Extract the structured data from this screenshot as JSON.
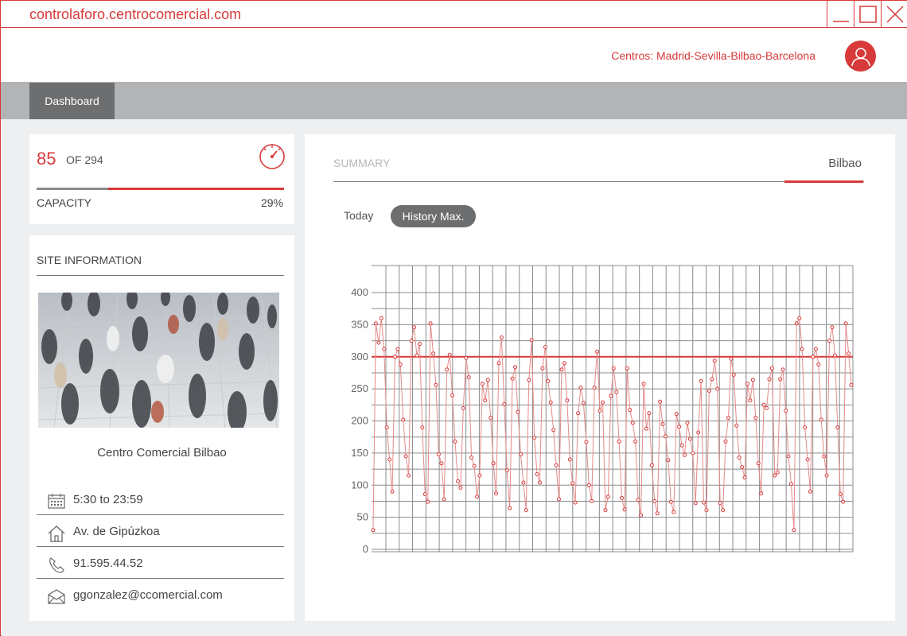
{
  "window": {
    "url": "controlaforo.centrocomercial.com"
  },
  "header": {
    "centros": "Centros: Madrid-Sevilla-Bilbao-Barcelona"
  },
  "nav": {
    "tabs": [
      {
        "label": "Dashboard",
        "active": true
      }
    ]
  },
  "capacity": {
    "count": "85",
    "of_text": "OF 294",
    "label": "CAPACITY",
    "percent_text": "29%",
    "fraction": 0.29
  },
  "site": {
    "heading": "SITE INFORMATION",
    "name": "Centro Comercial Bilbao",
    "hours": "5:30 to 23:59",
    "address": "Av. de Gipúzkoa",
    "phone": "91.595.44.52",
    "email": "ggonzalez@ccomercial.com"
  },
  "summary": {
    "tab": "SUMMARY",
    "location": "Bilbao",
    "filters": {
      "today": "Today",
      "history": "History Max."
    }
  },
  "colors": {
    "accent": "#d83a3a",
    "dark_gray": "#6d6e70",
    "nav_gray": "#b3b4b6",
    "background": "#eeeff1"
  },
  "icons": {
    "window_buttons": [
      "minimize-icon",
      "maximize-icon",
      "close-icon"
    ],
    "user": "user-icon",
    "gauge": "speedometer-icon",
    "rows": [
      "calendar-icon",
      "home-icon",
      "phone-icon",
      "envelope-icon"
    ]
  },
  "chart_data": {
    "type": "line",
    "yticks": [
      0,
      50,
      100,
      150,
      200,
      250,
      300,
      350,
      400
    ],
    "ylim": [
      0,
      400
    ],
    "threshold": 300,
    "series": [
      {
        "values": [
          30,
          352,
          322,
          360,
          312,
          190,
          140,
          90,
          300,
          312,
          288,
          202,
          145,
          115,
          325,
          346,
          302,
          320,
          190,
          86,
          74,
          352,
          305,
          256,
          148,
          134,
          78,
          280,
          303,
          240,
          168,
          106,
          96,
          220,
          298,
          268,
          143,
          130,
          82,
          115,
          258,
          232,
          264,
          205,
          134,
          87,
          290,
          330,
          226,
          123,
          64,
          266,
          284,
          214,
          148,
          104,
          61,
          264,
          326,
          174,
          117,
          104,
          282,
          315,
          262,
          229,
          186,
          131,
          78,
          280,
          290,
          232,
          140,
          103,
          73,
          212,
          252,
          228,
          167,
          100,
          75,
          252,
          308,
          216,
          229,
          61,
          82,
          239,
          282,
          245,
          168,
          80,
          62,
          282,
          217,
          197,
          168,
          77,
          53,
          258,
          188,
          212,
          131,
          75,
          56,
          230,
          195,
          176,
          139,
          74,
          58,
          211,
          191,
          162,
          147,
          197,
          172,
          150,
          72,
          182,
          262,
          73,
          61,
          247,
          265,
          294,
          250,
          72,
          61,
          168,
          205,
          297,
          272,
          193,
          143,
          128,
          112,
          258,
          232,
          264,
          205,
          134,
          87,
          225,
          220,
          265,
          282,
          115,
          120,
          265,
          280,
          216,
          145,
          102,
          30,
          352,
          360,
          312,
          190,
          140,
          90,
          300,
          312,
          288,
          202,
          145,
          115,
          325,
          346,
          302,
          190,
          86,
          74,
          352,
          305,
          256
        ]
      }
    ]
  }
}
